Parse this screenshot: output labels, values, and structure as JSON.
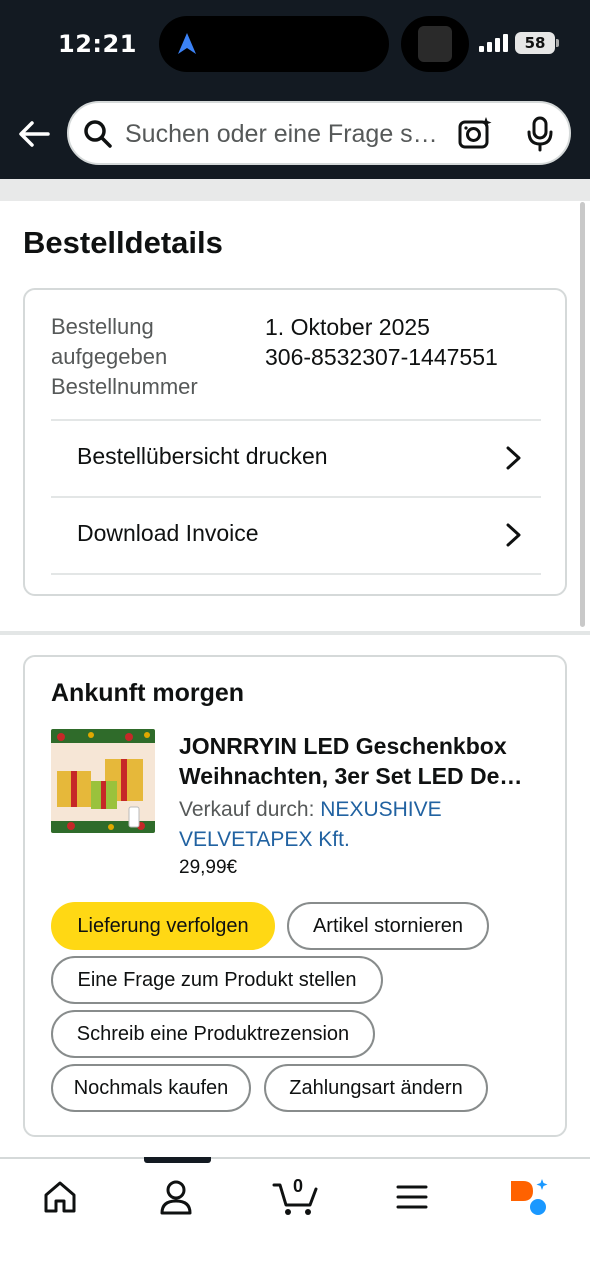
{
  "status_bar": {
    "time": "12:21",
    "battery": "58"
  },
  "header": {
    "search_placeholder": "Suchen oder eine Frage s…"
  },
  "page": {
    "title": "Bestelldetails"
  },
  "order": {
    "label_placed": "Bestellung",
    "label_placed_2": "aufgegeben",
    "label_number": "Bestellnummer",
    "date": "1. Oktober 2025",
    "number": "306-8532307-1447551",
    "actions": [
      {
        "label": "Bestellübersicht drucken"
      },
      {
        "label": "Download Invoice"
      }
    ]
  },
  "shipment": {
    "arrival": "Ankunft morgen",
    "product": {
      "title_line1": "JONRRYIN LED Geschenkbox",
      "title_line2": "Weihnachten, 3er Set LED De…",
      "sold_by_label": "Verkauf durch:",
      "seller_line1": "NEXUSHIVE",
      "seller_line2": "VELVETAPEX Kft.",
      "price": "29,99€"
    },
    "buttons": {
      "track": "Lieferung verfolgen",
      "cancel": "Artikel stornieren",
      "question": "Eine Frage zum Produkt stellen",
      "review": "Schreib eine Produktrezension",
      "buy_again": "Nochmals kaufen",
      "payment": "Zahlungsart ändern"
    }
  },
  "nav": {
    "cart_count": "0"
  },
  "colors": {
    "header_bg": "#131a22",
    "primary_button": "#ffd814",
    "link": "#2162a1",
    "ai_orange": "#ff6200",
    "ai_blue": "#1a98ff"
  }
}
